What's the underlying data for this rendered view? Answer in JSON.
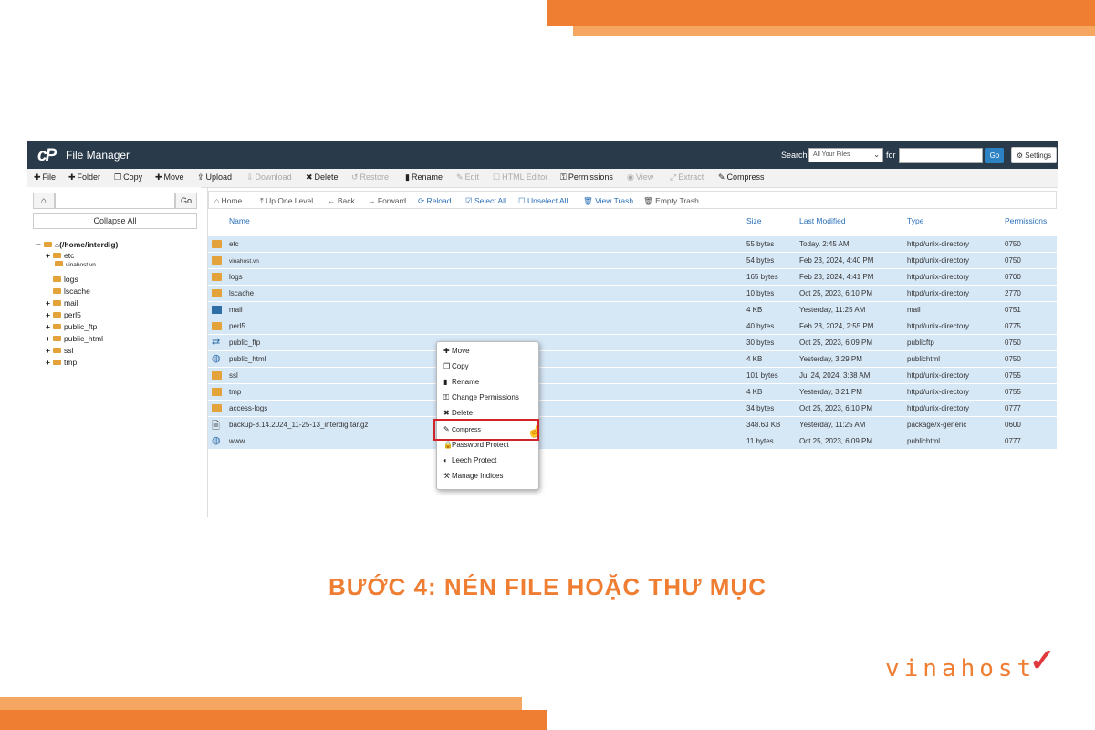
{
  "app": {
    "title": "File Manager",
    "logo": "cP",
    "search": {
      "label": "Search",
      "scope": "All Your Files",
      "for_label": "for",
      "go": "Go"
    },
    "settings": "Settings"
  },
  "toolbar": {
    "file": "File",
    "folder": "Folder",
    "copy": "Copy",
    "move": "Move",
    "upload": "Upload",
    "download": "Download",
    "delete": "Delete",
    "restore": "Restore",
    "rename": "Rename",
    "edit": "Edit",
    "html_editor": "HTML Editor",
    "permissions": "Permissions",
    "view": "View",
    "extract": "Extract",
    "compress": "Compress"
  },
  "left_panel": {
    "go": "Go",
    "collapse": "Collapse All",
    "tree": {
      "root": "(/home/interdig)",
      "etc": "etc",
      "vinahost": "vinahost.vn",
      "logs": "logs",
      "lscache": "lscache",
      "mail": "mail",
      "perl5": "perl5",
      "public_ftp": "public_ftp",
      "public_html": "public_html",
      "ssl": "ssl",
      "tmp": "tmp"
    }
  },
  "navbar": {
    "home": "Home",
    "up": "Up One Level",
    "back": "Back",
    "forward": "Forward",
    "reload": "Reload",
    "select_all": "Select All",
    "unselect_all": "Unselect All",
    "view_trash": "View Trash",
    "empty_trash": "Empty Trash"
  },
  "columns": {
    "name": "Name",
    "size": "Size",
    "modified": "Last Modified",
    "type": "Type",
    "perms": "Permissions"
  },
  "files": [
    {
      "name": "etc",
      "size": "55 bytes",
      "modified": "Today, 2:45 AM",
      "type": "httpd/unix-directory",
      "perms": "0750"
    },
    {
      "name": "vinahost.vn",
      "size": "54 bytes",
      "modified": "Feb 23, 2024, 4:40 PM",
      "type": "httpd/unix-directory",
      "perms": "0750"
    },
    {
      "name": "logs",
      "size": "165 bytes",
      "modified": "Feb 23, 2024, 4:41 PM",
      "type": "httpd/unix-directory",
      "perms": "0700"
    },
    {
      "name": "lscache",
      "size": "10 bytes",
      "modified": "Oct 25, 2023, 6:10 PM",
      "type": "httpd/unix-directory",
      "perms": "2770"
    },
    {
      "name": "mail",
      "size": "4 KB",
      "modified": "Yesterday, 11:25 AM",
      "type": "mail",
      "perms": "0751"
    },
    {
      "name": "perl5",
      "size": "40 bytes",
      "modified": "Feb 23, 2024, 2:55 PM",
      "type": "httpd/unix-directory",
      "perms": "0775"
    },
    {
      "name": "public_ftp",
      "size": "30 bytes",
      "modified": "Oct 25, 2023, 6:09 PM",
      "type": "publicftp",
      "perms": "0750"
    },
    {
      "name": "public_html",
      "size": "4 KB",
      "modified": "Yesterday, 3:29 PM",
      "type": "publichtml",
      "perms": "0750"
    },
    {
      "name": "ssl",
      "size": "101 bytes",
      "modified": "Jul 24, 2024, 3:38 AM",
      "type": "httpd/unix-directory",
      "perms": "0755"
    },
    {
      "name": "tmp",
      "size": "4 KB",
      "modified": "Yesterday, 3:21 PM",
      "type": "httpd/unix-directory",
      "perms": "0755"
    },
    {
      "name": "access-logs",
      "size": "34 bytes",
      "modified": "Oct 25, 2023, 6:10 PM",
      "type": "httpd/unix-directory",
      "perms": "0777"
    },
    {
      "name": "backup-8.14.2024_11-25-13_interdig.tar.gz",
      "size": "348.63 KB",
      "modified": "Yesterday, 11:25 AM",
      "type": "package/x-generic",
      "perms": "0600"
    },
    {
      "name": "www",
      "size": "11 bytes",
      "modified": "Oct 25, 2023, 6:09 PM",
      "type": "publichtml",
      "perms": "0777"
    }
  ],
  "context_menu": {
    "move": "Move",
    "copy": "Copy",
    "rename": "Rename",
    "change_permissions": "Change Permissions",
    "delete": "Delete",
    "compress": "Compress",
    "password_protect": "Password Protect",
    "leech_protect": "Leech Protect",
    "manage_indices": "Manage Indices"
  },
  "caption": "BƯỚC 4: NÉN FILE HOẶC THƯ MỤC",
  "brand": "vinahost",
  "colors": {
    "accent_orange": "#ef7d32",
    "light_orange": "#f5a660",
    "titlebar": "#293a4a",
    "row_selected": "#d6e7f6",
    "highlight_red": "#d2232a",
    "link_blue": "#2a6fb8"
  }
}
